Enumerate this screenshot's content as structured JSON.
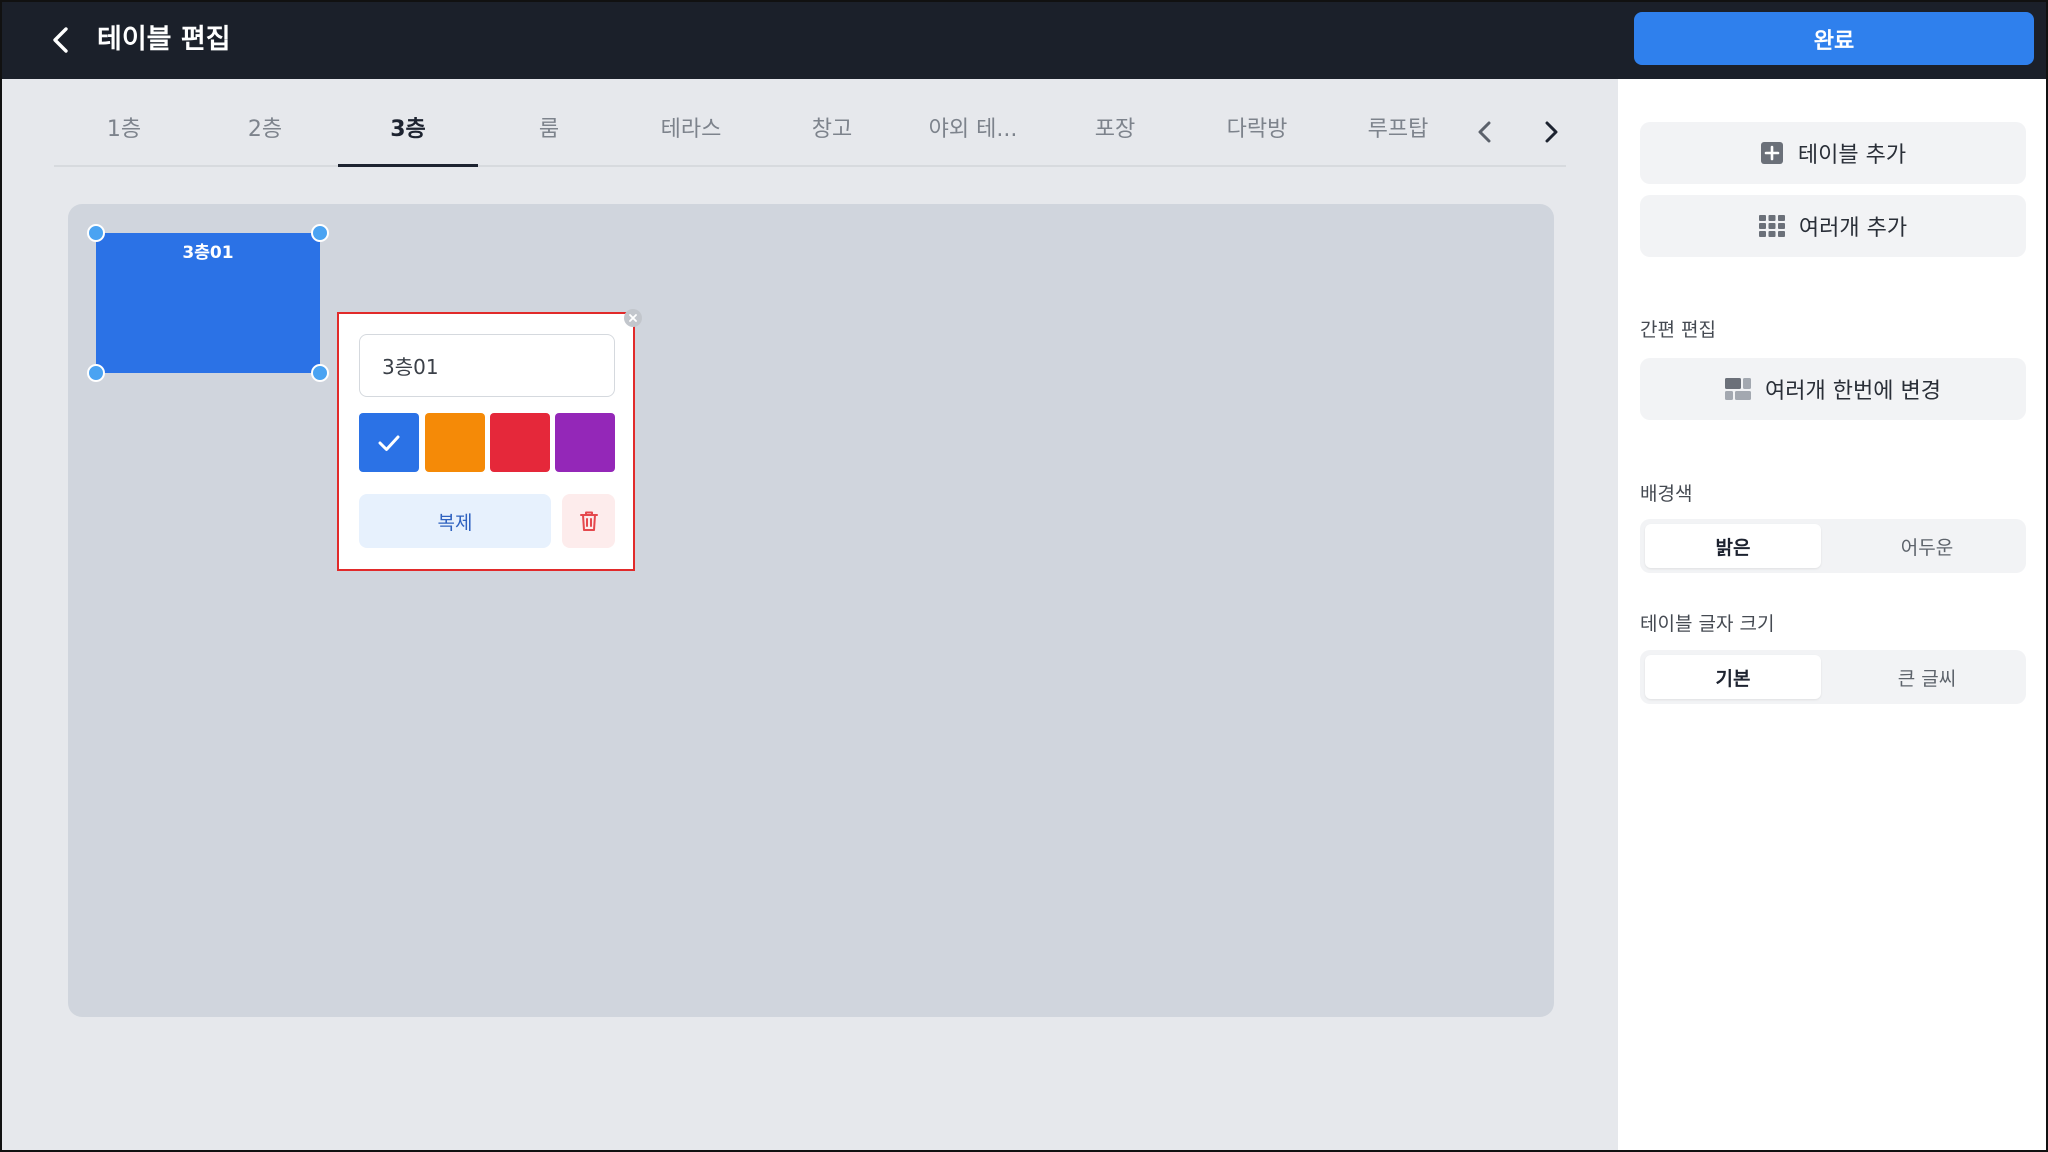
{
  "header": {
    "title": "테이블 편집",
    "done_label": "완료"
  },
  "tabs": [
    {
      "label": "1층"
    },
    {
      "label": "2층"
    },
    {
      "label": "3층",
      "active": true
    },
    {
      "label": "룸"
    },
    {
      "label": "테라스"
    },
    {
      "label": "창고"
    },
    {
      "label": "야외 테..."
    },
    {
      "label": "포장"
    },
    {
      "label": "다락방"
    },
    {
      "label": "루프탑"
    }
  ],
  "canvas": {
    "table": {
      "label": "3층01",
      "color": "#2b72e6"
    }
  },
  "editor": {
    "name_value": "3층01",
    "colors": [
      {
        "name": "blue",
        "hex": "#2b72e6",
        "selected": true
      },
      {
        "name": "orange",
        "hex": "#f58a07"
      },
      {
        "name": "red",
        "hex": "#e5283a"
      },
      {
        "name": "purple",
        "hex": "#9427b8"
      }
    ],
    "copy_label": "복제"
  },
  "sidebar": {
    "add_table_label": "테이블 추가",
    "add_multiple_label": "여러개 추가",
    "quick_edit_heading": "간편 편집",
    "bulk_change_label": "여러개 한번에 변경",
    "background_heading": "배경색",
    "background_options": {
      "light": "밝은",
      "dark": "어두운",
      "selected": "light"
    },
    "font_size_heading": "테이블 글자 크기",
    "font_size_options": {
      "default": "기본",
      "large": "큰 글씨",
      "selected": "default"
    }
  },
  "colors": {
    "accent": "#2f80ed",
    "header_bg": "#1b202a",
    "highlight_border": "#e12a2a"
  }
}
